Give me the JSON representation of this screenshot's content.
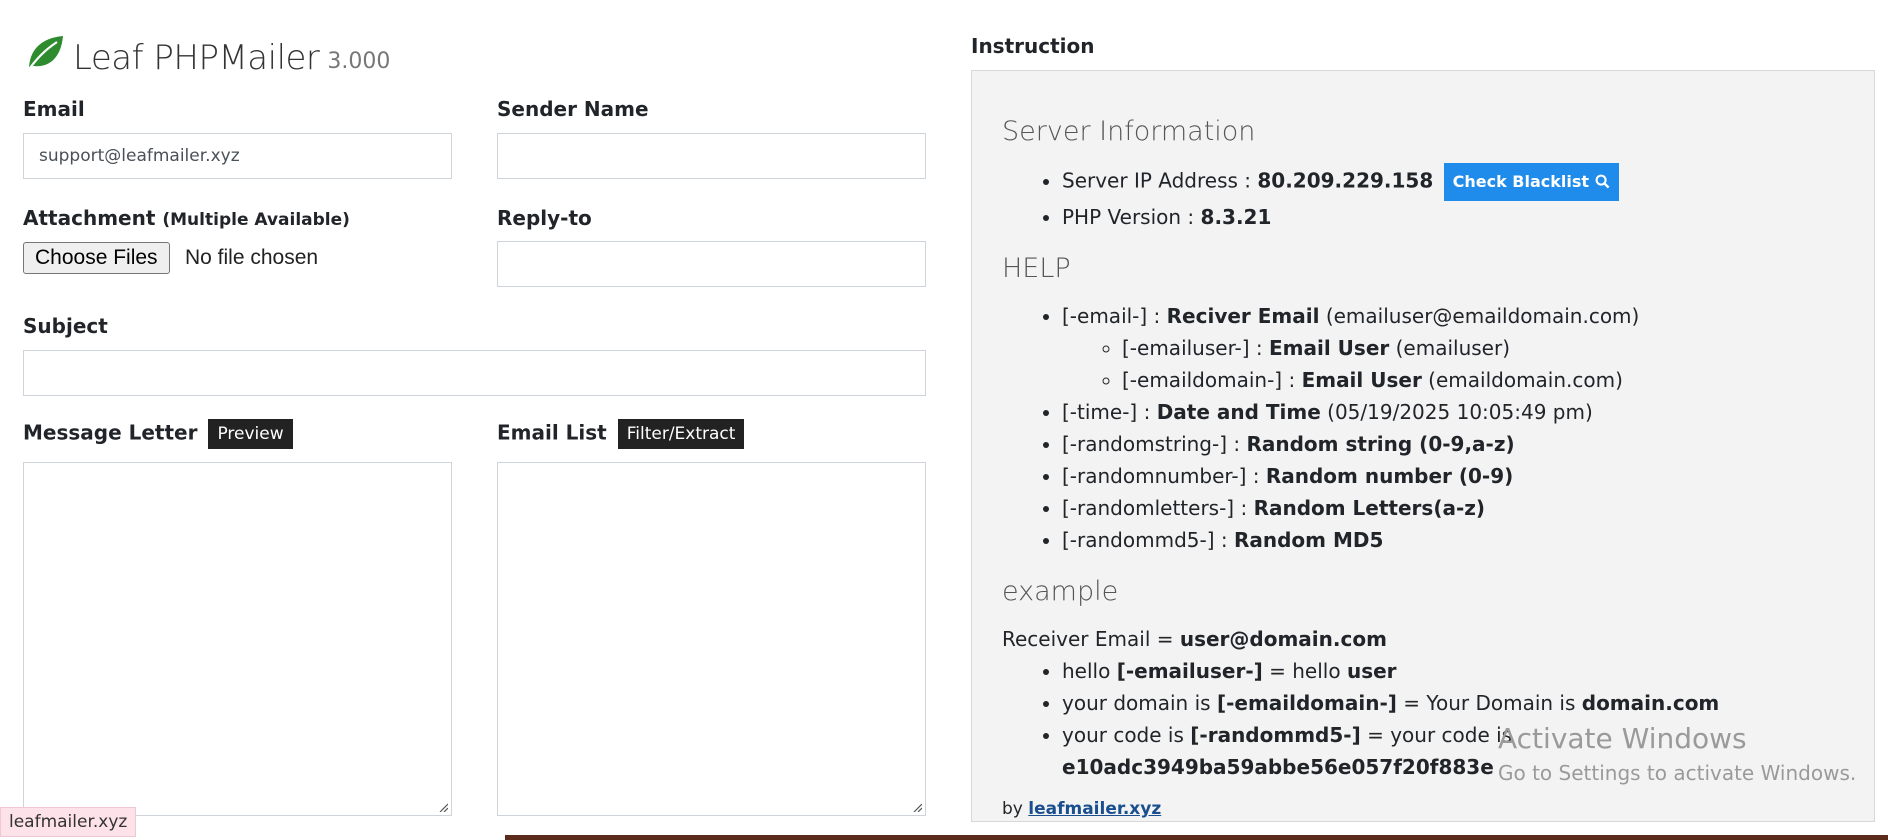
{
  "brand": {
    "name": "Leaf PHPMailer",
    "version": "3.000"
  },
  "form": {
    "email_label": "Email",
    "email_value": "support@leafmailer.xyz",
    "sender_name_label": "Sender Name",
    "sender_name_value": "",
    "attachment_label": "Attachment",
    "attachment_note": "(Multiple Available)",
    "choose_files_label": "Choose Files",
    "no_file_text": "No file chosen",
    "reply_to_label": "Reply-to",
    "reply_to_value": "",
    "subject_label": "Subject",
    "subject_value": "",
    "message_label": "Message Letter",
    "preview_label": "Preview",
    "email_list_label": "Email List",
    "filter_label": "Filter/Extract"
  },
  "instruction": {
    "title": "Instruction",
    "server_heading": "Server Information",
    "server_ip_label": "Server IP Address :",
    "server_ip": "80.209.229.158",
    "check_blacklist": "Check Blacklist",
    "php_label": "PHP Version :",
    "php_version": "8.3.21",
    "help_heading": "HELP",
    "help": [
      {
        "tag": "[-email-] :",
        "name": "Reciver Email",
        "note": "(emailuser@emaildomain.com)"
      },
      {
        "tag": "[-emailuser-] :",
        "name": "Email User",
        "note": "(emailuser)"
      },
      {
        "tag": "[-emaildomain-] :",
        "name": "Email User",
        "note": "(emaildomain.com)"
      },
      {
        "tag": "[-time-] :",
        "name": "Date and Time",
        "note": "(05/19/2025 10:05:49 pm)"
      },
      {
        "tag": "[-randomstring-] :",
        "name": "Random string (0-9,a-z)",
        "note": ""
      },
      {
        "tag": "[-randomnumber-] :",
        "name": "Random number (0-9)",
        "note": ""
      },
      {
        "tag": "[-randomletters-] :",
        "name": "Random Letters(a-z)",
        "note": ""
      },
      {
        "tag": "[-randommd5-] :",
        "name": "Random MD5",
        "note": ""
      }
    ],
    "example_heading": "example",
    "receiver_label": "Receiver Email =",
    "receiver_value": "user@domain.com",
    "examples": [
      {
        "pre": "hello",
        "tag": "[-emailuser-]",
        "mid": "= hello",
        "val": "user"
      },
      {
        "pre": "your domain is",
        "tag": "[-emaildomain-]",
        "mid": "= Your Domain is",
        "val": "domain.com"
      },
      {
        "pre": "your code is",
        "tag": "[-randommd5-]",
        "mid": "= your code is",
        "val": "e10adc3949ba59abbe56e057f20f883e"
      }
    ],
    "by_text": "by",
    "by_link": "leafmailer.xyz"
  },
  "watermark": {
    "line1": "Activate Windows",
    "line2": "Go to Settings to activate Windows."
  },
  "status_tip": "leafmailer.xyz",
  "colors": {
    "leaf": "#2e8b2e",
    "blacklist_button": "#1f8bea",
    "dark_button": "#222222"
  }
}
